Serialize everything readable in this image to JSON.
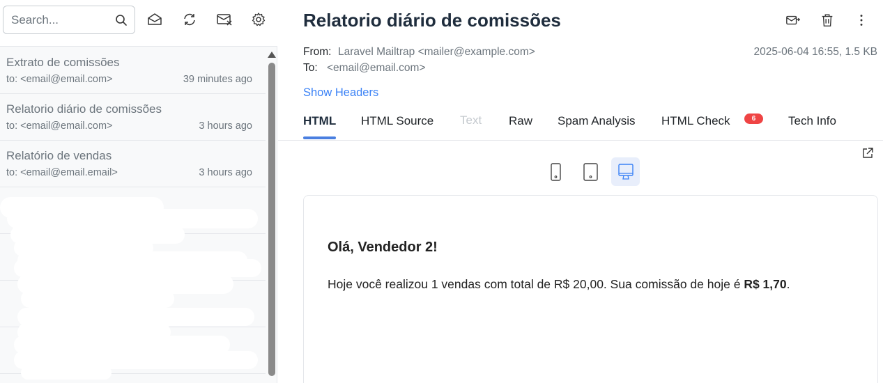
{
  "search": {
    "placeholder": "Search..."
  },
  "toolbar_icons": [
    "envelope-open-icon",
    "refresh-icon",
    "mark-read-icon",
    "gear-icon"
  ],
  "messages": [
    {
      "subject": "Extrato de comissões",
      "to": "to: <email@email.com>",
      "time": "39 minutes ago"
    },
    {
      "subject": "Relatorio diário de comissões",
      "to": "to: <email@email.com>",
      "time": "3 hours ago"
    },
    {
      "subject": "Relatório de vendas",
      "to": "to: <email@email.email>",
      "time": "3 hours ago"
    }
  ],
  "email": {
    "title": "Relatorio diário de comissões",
    "from_label": "From:",
    "from_value": "Laravel Mailtrap <mailer@example.com>",
    "to_label": "To:",
    "to_value": "<email@email.com>",
    "meta": "2025-06-04 16:55, 1.5 KB",
    "show_headers": "Show Headers"
  },
  "tabs": [
    {
      "label": "HTML",
      "state": "active"
    },
    {
      "label": "HTML Source",
      "state": "normal"
    },
    {
      "label": "Text",
      "state": "disabled"
    },
    {
      "label": "Raw",
      "state": "normal"
    },
    {
      "label": "Spam Analysis",
      "state": "normal"
    },
    {
      "label": "HTML Check",
      "state": "normal",
      "badge": "6"
    },
    {
      "label": "Tech Info",
      "state": "normal"
    }
  ],
  "preview": {
    "greeting": "Olá, Vendedor 2!",
    "body_prefix": "Hoje você realizou 1 vendas com total de R$ 20,00. Sua comissão de hoje é ",
    "body_bold": "R$ 1,70",
    "body_suffix": "."
  },
  "colors": {
    "accent": "#3b82f6",
    "badge": "#ef4444",
    "active_device_bg": "#e8eefb"
  }
}
